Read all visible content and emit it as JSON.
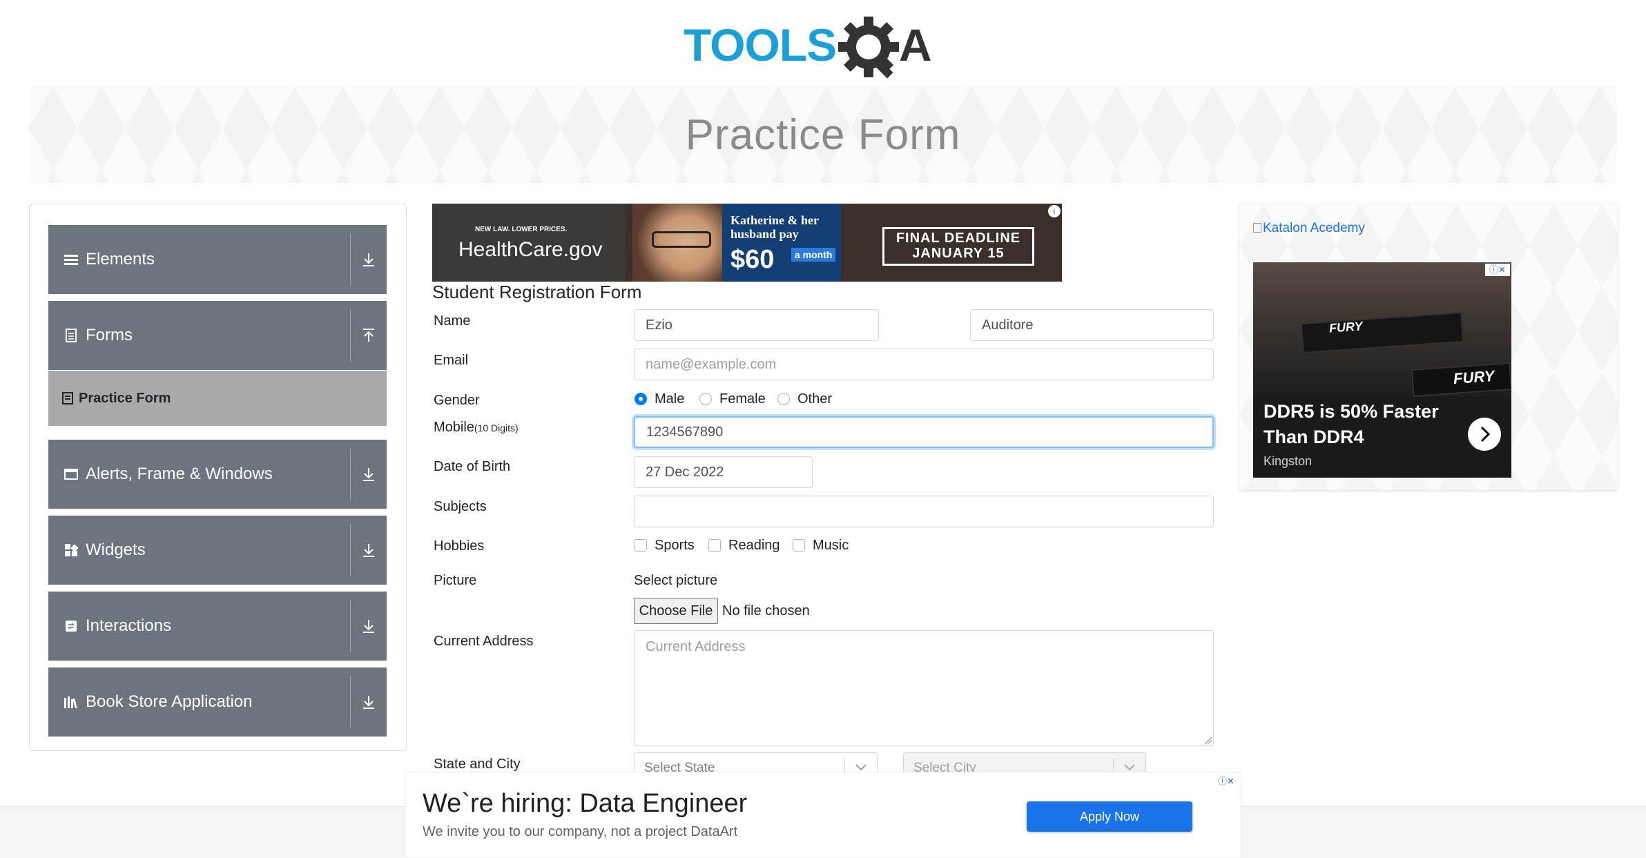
{
  "logo": {
    "text_left": "TOOLS",
    "text_right": "A",
    "colors": {
      "tools": "#1a9fd9",
      "qa": "#333333"
    }
  },
  "banner": {
    "title": "Practice Form"
  },
  "sidebar": {
    "groups": [
      {
        "label": "Elements",
        "icon": "hamburger-icon"
      },
      {
        "label": "Forms",
        "icon": "document-icon",
        "expanded": true,
        "items": [
          {
            "label": "Practice Form",
            "active": true
          }
        ]
      },
      {
        "label": "Alerts, Frame & Windows",
        "icon": "window-icon"
      },
      {
        "label": "Widgets",
        "icon": "widgets-icon"
      },
      {
        "label": "Interactions",
        "icon": "interactions-icon"
      },
      {
        "label": "Book Store Application",
        "icon": "books-icon"
      }
    ]
  },
  "top_ad": {
    "small_text": "NEW LAW. LOWER PRICES.",
    "brand": "HealthCare.gov",
    "headline": "Katherine & her husband pay",
    "price": "$60",
    "price_unit": "a month",
    "deadline_line1": "FINAL DEADLINE",
    "deadline_line2": "JANUARY 15"
  },
  "form": {
    "title": "Student Registration Form",
    "name_label": "Name",
    "first_name": "Ezio",
    "last_name": "Auditore",
    "email_label": "Email",
    "email_placeholder": "name@example.com",
    "gender_label": "Gender",
    "gender_options": [
      "Male",
      "Female",
      "Other"
    ],
    "gender_selected": "Male",
    "mobile_label": "Mobile",
    "mobile_hint": "(10 Digits)",
    "mobile_value": "1234567890",
    "dob_label": "Date of Birth",
    "dob_value": "27 Dec 2022",
    "subjects_label": "Subjects",
    "hobbies_label": "Hobbies",
    "hobbies": [
      "Sports",
      "Reading",
      "Music"
    ],
    "picture_label": "Picture",
    "select_picture": "Select picture",
    "choose_file": "Choose File",
    "no_file": "No file chosen",
    "address_label": "Current Address",
    "address_placeholder": "Current Address",
    "state_city_label": "State and City",
    "state_placeholder": "Select State",
    "city_placeholder": "Select City"
  },
  "right_ad": {
    "link_text": "Katalon Acedemy",
    "headline_line1": "DDR5 is 50% Faster",
    "headline_line2": "Than DDR4",
    "brand": "Kingston",
    "product_word": "FURY"
  },
  "bottom_ad": {
    "headline": "We`re hiring: Data Engineer",
    "description": "We invite you to our company, not a project DataArt",
    "button": "Apply Now"
  }
}
